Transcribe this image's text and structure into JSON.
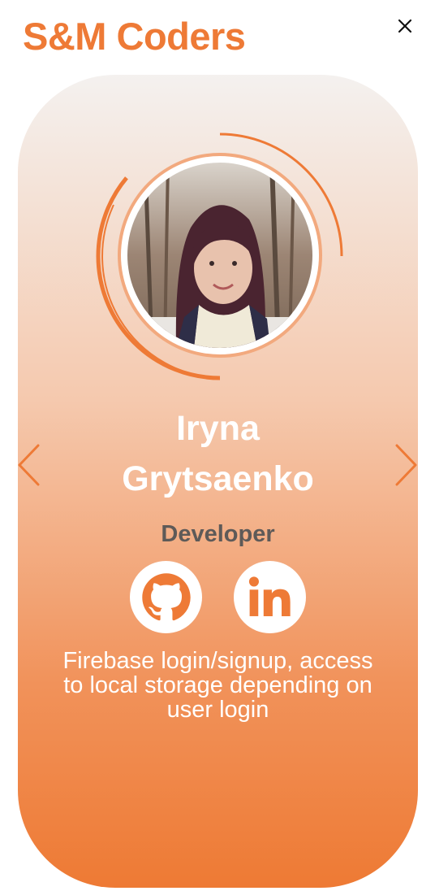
{
  "header": {
    "brand": "S&M Coders",
    "close_icon": "close-icon"
  },
  "profile": {
    "name_first": "Iryna",
    "name_last": "Grytsaenko",
    "role": "Developer",
    "description": "Firebase login/signup, access to local storage depending on user login",
    "photo": "profile-photo"
  },
  "social": {
    "github_icon": "github-icon",
    "linkedin_icon": "linkedin-icon"
  },
  "navigation": {
    "prev_icon": "chevron-left-icon",
    "next_icon": "chevron-right-icon"
  },
  "colors": {
    "accent": "#ee7a36",
    "card_top": "#f4f1ef",
    "card_bottom": "#ee7a34",
    "role_text": "#5e5a58"
  }
}
